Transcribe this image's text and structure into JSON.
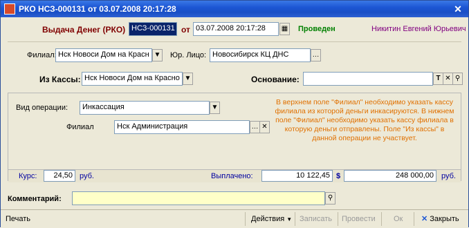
{
  "window": {
    "title": "РКО НСЗ-000131 от 03.07.2008 20:17:28",
    "close_glyph": "✕"
  },
  "header": {
    "doc_type": "Выдача Денег (РКО)",
    "number": "НСЗ-000131",
    "date_label": "от",
    "date_value": "03.07.2008 20:17:28",
    "status": "Проведен",
    "user": "Никитин Евгений Юрьевич",
    "colors": {
      "doc_type": "#800000",
      "status": "#008000",
      "user": "#800080"
    }
  },
  "branch": {
    "label": "Филиал:",
    "value": "Нск Новоси Дом на Красн",
    "legal_label": "Юр. Лицо:",
    "legal_value": "Новосибирск КЦ ДНС"
  },
  "cashbox": {
    "label": "Из Кассы:",
    "value": "Нск Новоси Дом на Красно",
    "basis_label": "Основание:",
    "basis_value": ""
  },
  "operation": {
    "type_label": "Вид операции:",
    "type_value": "Инкассация",
    "branch_label": "Филиал",
    "branch_value": "Нск Администрация",
    "hint": "В верхнем поле \"Филиал\" необходимо указать кассу филиала из которой деньги инкасируются. В нижнем поле \"Филиал\" необходимо указать кассу филиала в которую деньги отправлены. Поле \"Из кассы\" в данной операции не участвует.",
    "hint_color": "#e07000"
  },
  "totals": {
    "rate_label": "Курс:",
    "rate_value": "24,50",
    "currency_rub": "руб.",
    "paid_label": "Выплачено:",
    "paid_usd": "10 122,45",
    "usd_sign": "$",
    "paid_rub": "248 000,00",
    "currency_rub2": "руб.",
    "label_color": "#0000a0"
  },
  "comment": {
    "label": "Комментарий:",
    "value": ""
  },
  "toolbar": {
    "print": "Печать",
    "actions": "Действия",
    "save": "Записать",
    "post": "Провести",
    "ok": "Ок",
    "close": "Закрыть"
  }
}
